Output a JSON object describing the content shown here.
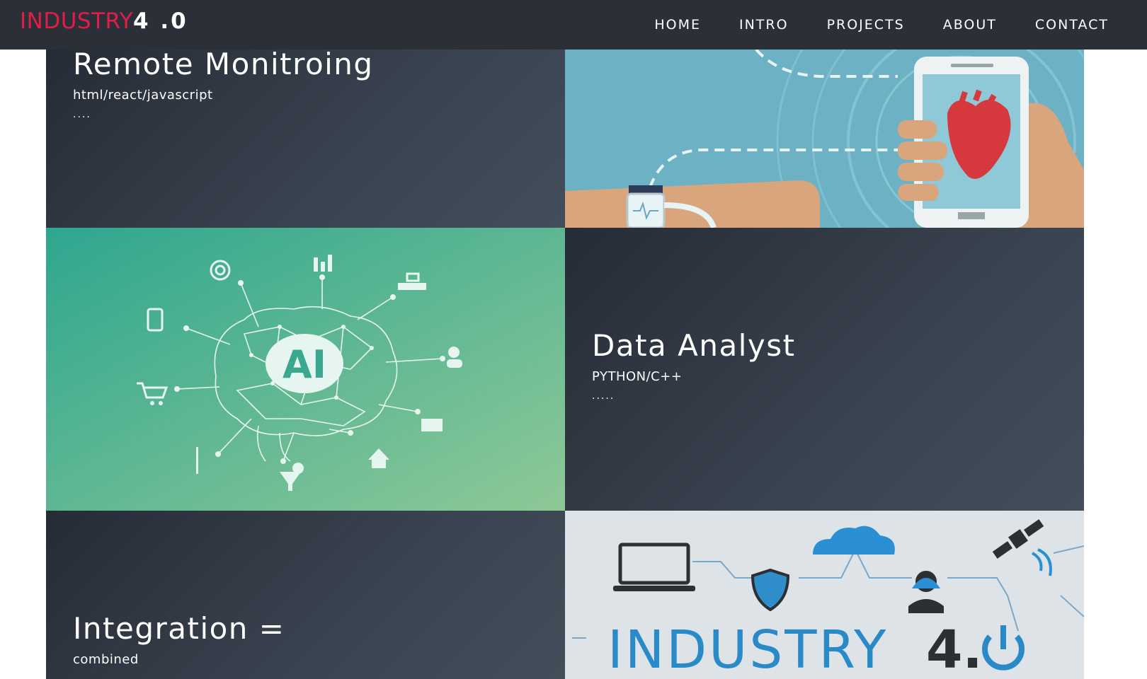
{
  "brand": {
    "part1": "INDUSTRY",
    "part2": "4 .0"
  },
  "nav": {
    "items": [
      "HOME",
      "INTRO",
      "PROJECTS",
      "ABOUT",
      "CONTACT"
    ]
  },
  "projects": [
    {
      "title": "Remote Monitroing",
      "tech": "html/react/javascript",
      "dots": "....",
      "image": "remote-health-monitoring-illustration"
    },
    {
      "title": "Data Analyst",
      "tech": "PYTHON/C++",
      "dots": ".....",
      "image": "ai-brain-network-illustration"
    },
    {
      "title": "Integration =",
      "tech": "combined",
      "image": "industry-4-illustration"
    }
  ],
  "images": {
    "industry_label": "INDUSTRY",
    "industry_version": "4.",
    "ai_label": "AI"
  },
  "colors": {
    "nav_bg": "#2a2f38",
    "brand_red": "#e11d48",
    "tile_dark": "#343c48",
    "teal": "#3aa891",
    "sky": "#6fb3c6"
  }
}
